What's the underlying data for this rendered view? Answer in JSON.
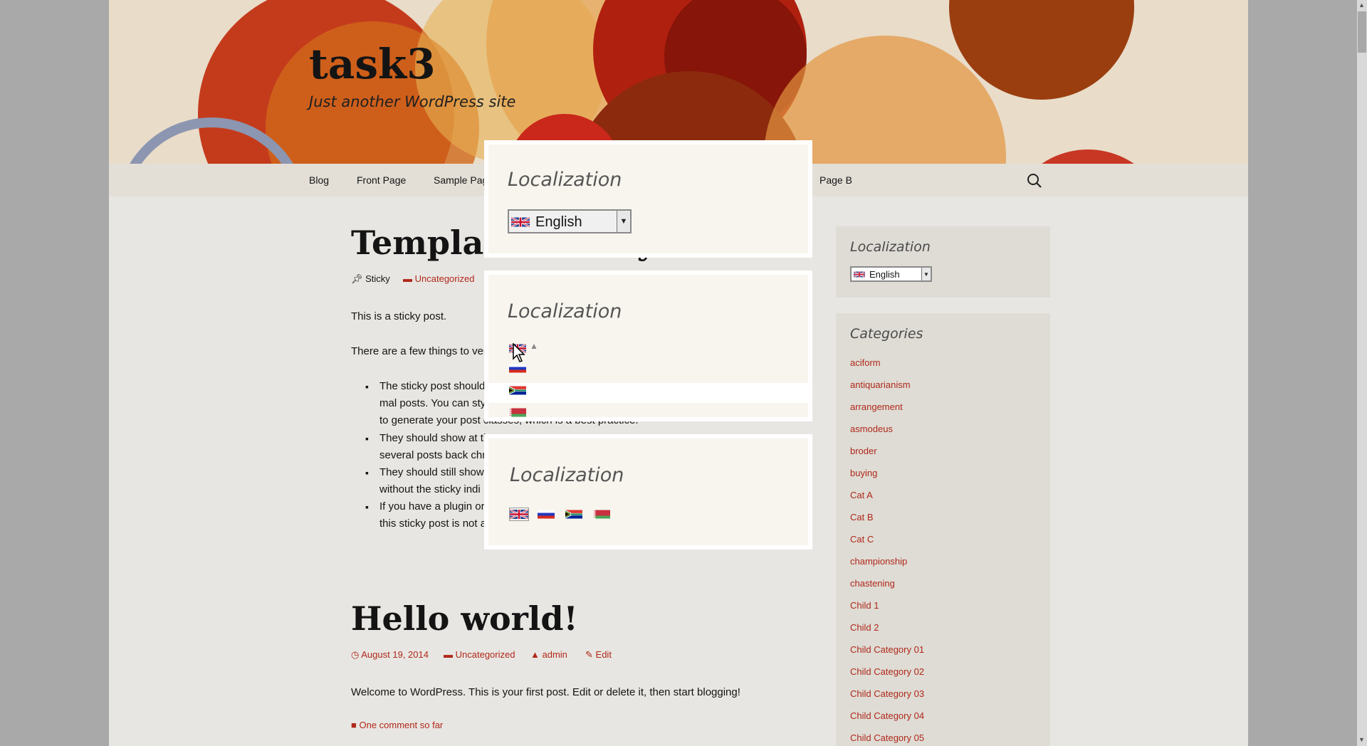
{
  "site": {
    "title": "task3",
    "tagline": "Just another WordPress site"
  },
  "nav": {
    "items": [
      {
        "label": "Blog"
      },
      {
        "label": "Front Page"
      },
      {
        "label": "Sample Pag"
      },
      {
        "label": "Page B"
      }
    ]
  },
  "posts": [
    {
      "title": "Template: Sticky",
      "meta_sticky": "Sticky",
      "meta_category": "Uncategorized",
      "paragraphs": [
        "This is a sticky post.",
        "There are a few things to ver"
      ],
      "bullets": [
        [
          "The sticky post should",
          "mal posts. You can sty",
          "to generate your post classes, which is a best practice."
        ],
        [
          "They should show at th",
          "several posts back chr"
        ],
        [
          "They should still show",
          "without the sticky indi"
        ],
        [
          "If you have a plugin or",
          "this sticky post is not a"
        ]
      ]
    },
    {
      "title": "Hello world!",
      "meta_date": "August 19, 2014",
      "meta_category": "Uncategorized",
      "meta_author": "admin",
      "meta_edit": "Edit",
      "body": "Welcome to WordPress. This is your first post. Edit or delete it, then start blogging!",
      "comments": "One comment so far"
    }
  ],
  "sidebar": {
    "localization_widget": {
      "title": "Localization",
      "selected": "English"
    },
    "categories_widget": {
      "title": "Categories",
      "items": [
        "aciform",
        "antiquarianism",
        "arrangement",
        "asmodeus",
        "broder",
        "buying",
        "Cat A",
        "Cat B",
        "Cat C",
        "championship",
        "chastening",
        "Child 1",
        "Child 2",
        "Child Category 01",
        "Child Category 02",
        "Child Category 03",
        "Child Category 04",
        "Child Category 05"
      ]
    }
  },
  "overlay": {
    "panel1": {
      "title": "Localization",
      "selected": "English"
    },
    "panel2": {
      "title": "Localization",
      "flags": [
        "uk-flag",
        "russia-flag",
        "south-africa-flag",
        "belarus-flag"
      ]
    },
    "panel3": {
      "title": "Localization",
      "flags": [
        "uk-flag",
        "russia-flag",
        "south-africa-flag",
        "belarus-flag"
      ]
    }
  },
  "colors": {
    "link": "#b0281a",
    "text": "#141414",
    "panel_bg": "#f7f5ee"
  }
}
